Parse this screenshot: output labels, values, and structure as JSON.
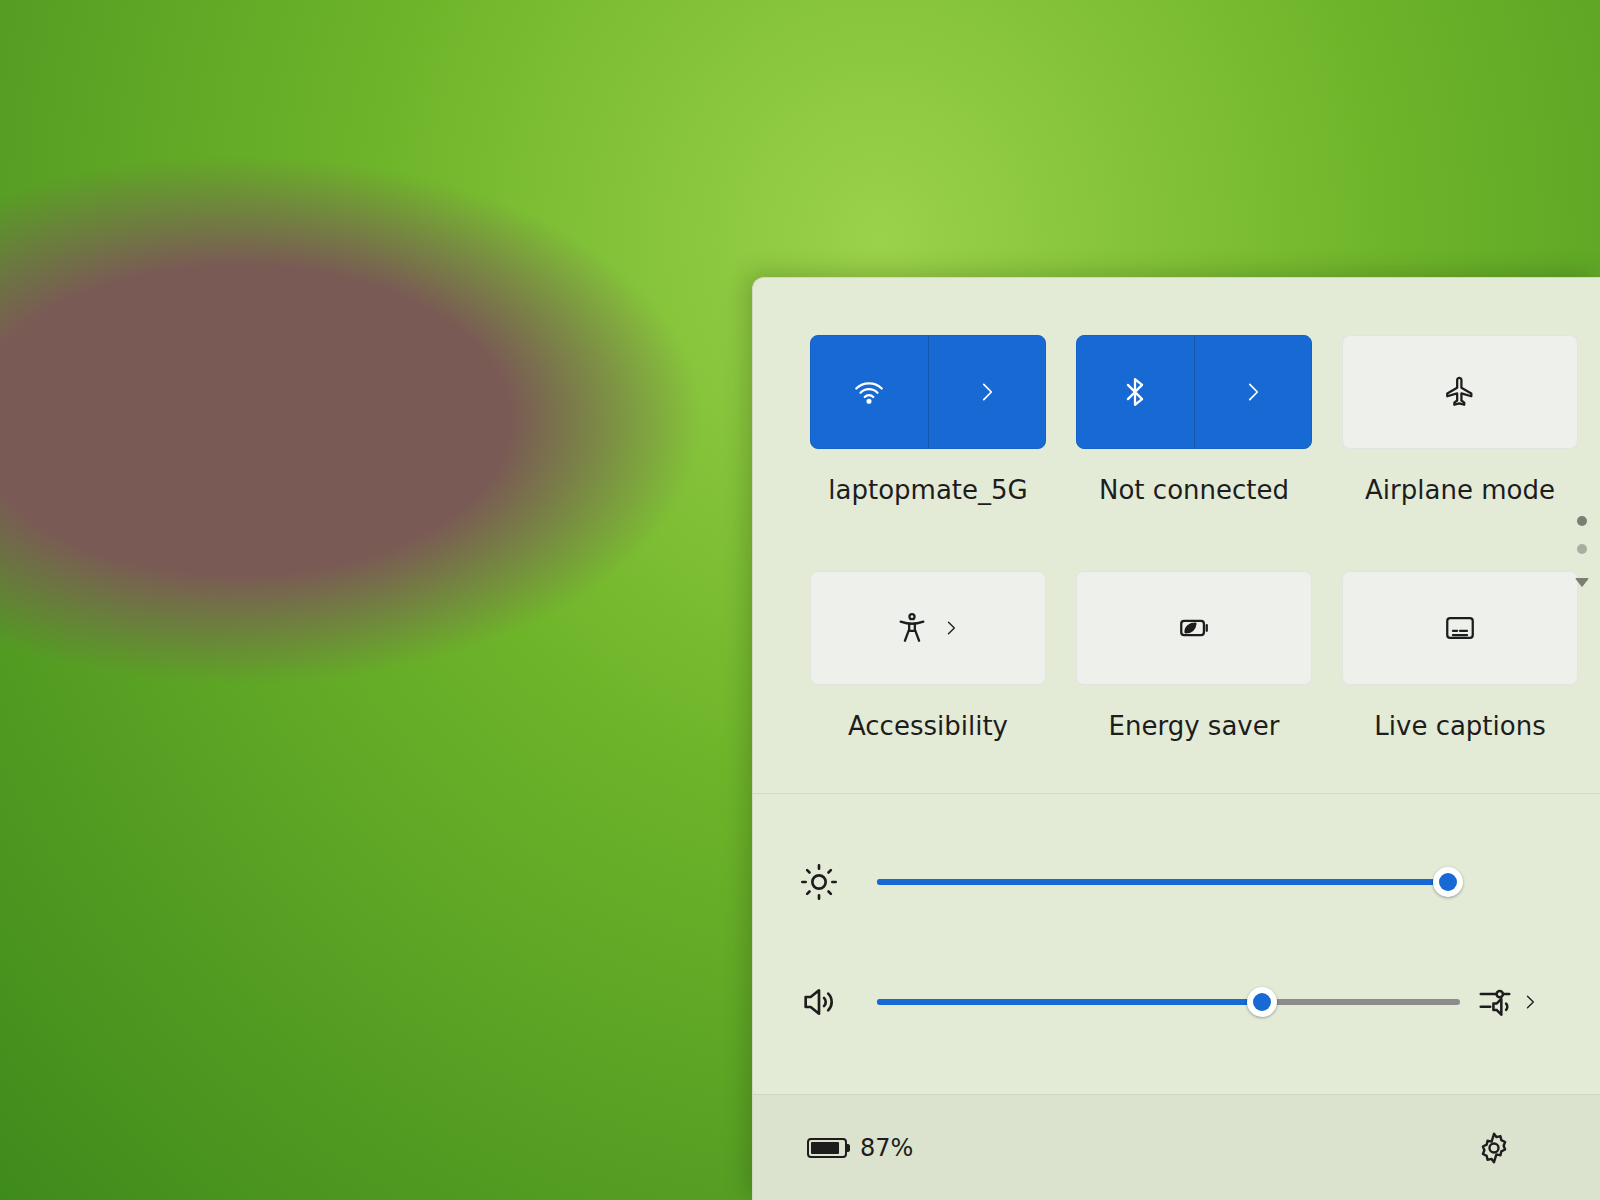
{
  "quick_settings": {
    "tiles": [
      {
        "label": "laptopmate_5G",
        "on": true,
        "kind": "split"
      },
      {
        "label": "Not connected",
        "on": true,
        "kind": "split"
      },
      {
        "label": "Airplane mode",
        "on": false,
        "kind": "toggle"
      },
      {
        "label": "Accessibility",
        "on": false,
        "kind": "expand"
      },
      {
        "label": "Energy saver",
        "on": false,
        "kind": "toggle"
      },
      {
        "label": "Live captions",
        "on": false,
        "kind": "toggle"
      }
    ],
    "pages": [
      {
        "selected": true
      },
      {
        "selected": false
      }
    ],
    "brightness": {
      "level": 0.98
    },
    "volume": {
      "level": 0.66
    },
    "battery": {
      "percent": "87%",
      "level": 0.87
    }
  }
}
